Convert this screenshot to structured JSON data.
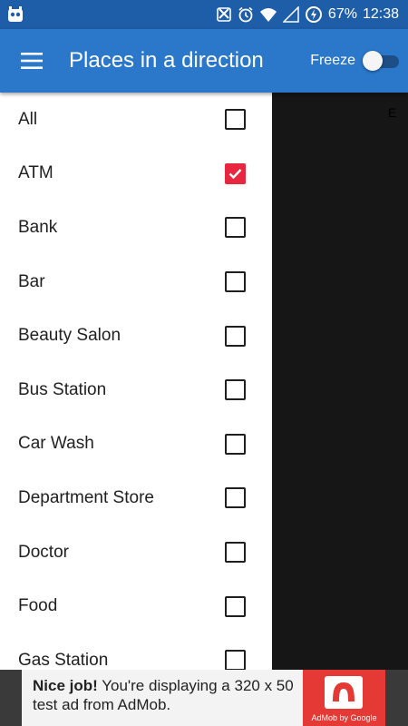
{
  "status_bar": {
    "battery_percent": "67%",
    "time": "12:38"
  },
  "app_bar": {
    "title": "Places in a direction",
    "freeze_label": "Freeze",
    "freeze_on": false
  },
  "background": {
    "partial_label": "E"
  },
  "drawer": {
    "items": [
      {
        "label": "All",
        "checked": false
      },
      {
        "label": "ATM",
        "checked": true
      },
      {
        "label": "Bank",
        "checked": false
      },
      {
        "label": "Bar",
        "checked": false
      },
      {
        "label": "Beauty Salon",
        "checked": false
      },
      {
        "label": "Bus Station",
        "checked": false
      },
      {
        "label": "Car Wash",
        "checked": false
      },
      {
        "label": "Department Store",
        "checked": false
      },
      {
        "label": "Doctor",
        "checked": false
      },
      {
        "label": "Food",
        "checked": false
      },
      {
        "label": "Gas Station",
        "checked": false
      }
    ]
  },
  "ad": {
    "headline": "Nice job!",
    "body": " You're displaying a 320 x 50 test ad from AdMob.",
    "brand": "AdMob by Google"
  },
  "colors": {
    "status_bar": "#1e5ea8",
    "app_bar": "#2b77c9",
    "checkbox_checked": "#e8263f",
    "ad_logo": "#e53935"
  }
}
